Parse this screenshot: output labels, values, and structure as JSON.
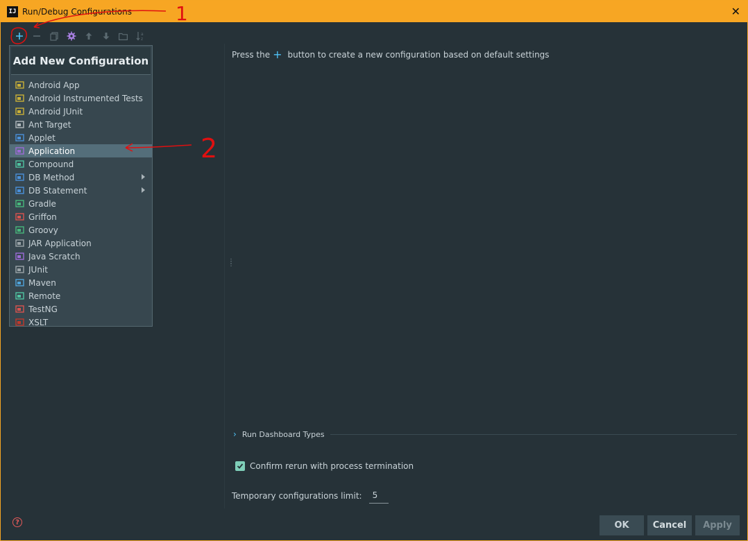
{
  "window": {
    "title": "Run/Debug Configurations",
    "icon_text": "IJ"
  },
  "toolbar": {
    "buttons": [
      {
        "name": "add-icon"
      },
      {
        "name": "remove-icon"
      },
      {
        "name": "copy-icon"
      },
      {
        "name": "settings-icon"
      },
      {
        "name": "move-up-icon"
      },
      {
        "name": "move-down-icon"
      },
      {
        "name": "folder-icon"
      },
      {
        "name": "sort-icon"
      }
    ]
  },
  "popup": {
    "header": "Add New Configuration",
    "items": [
      {
        "label": "Android App",
        "icon": "android-app-icon",
        "color": "#c9b038"
      },
      {
        "label": "Android Instrumented Tests",
        "icon": "android-tests-icon",
        "color": "#c9b038"
      },
      {
        "label": "Android JUnit",
        "icon": "android-junit-icon",
        "color": "#c9b038"
      },
      {
        "label": "Ant Target",
        "icon": "ant-icon",
        "color": "#b0b8bc"
      },
      {
        "label": "Applet",
        "icon": "applet-icon",
        "color": "#4a90d9"
      },
      {
        "label": "Application",
        "icon": "application-icon",
        "color": "#9b6bd6",
        "selected": true
      },
      {
        "label": "Compound",
        "icon": "compound-icon",
        "color": "#4fc3a1"
      },
      {
        "label": "DB Method",
        "icon": "db-method-icon",
        "color": "#4a90d9",
        "submenu": true
      },
      {
        "label": "DB Statement",
        "icon": "db-statement-icon",
        "color": "#4a90d9",
        "submenu": true
      },
      {
        "label": "Gradle",
        "icon": "gradle-icon",
        "color": "#48b77c"
      },
      {
        "label": "Griffon",
        "icon": "griffon-icon",
        "color": "#d9534f"
      },
      {
        "label": "Groovy",
        "icon": "groovy-icon",
        "color": "#48b77c"
      },
      {
        "label": "JAR Application",
        "icon": "jar-icon",
        "color": "#9aa4a8"
      },
      {
        "label": "Java Scratch",
        "icon": "java-scratch-icon",
        "color": "#9b6bd6"
      },
      {
        "label": "JUnit",
        "icon": "junit-icon",
        "color": "#9aa4a8"
      },
      {
        "label": "Maven",
        "icon": "maven-icon",
        "color": "#4fa3d9"
      },
      {
        "label": "Remote",
        "icon": "remote-icon",
        "color": "#4fc3a1"
      },
      {
        "label": "TestNG",
        "icon": "testng-icon",
        "color": "#d9534f"
      },
      {
        "label": "XSLT",
        "icon": "xslt-icon",
        "color": "#c0392b"
      }
    ]
  },
  "main": {
    "hint_before": "Press the",
    "hint_plus": "+",
    "hint_after": "button to create a new configuration based on default settings",
    "dashboard_label": "Run Dashboard Types",
    "confirm_label": "Confirm rerun with process termination",
    "confirm_checked": true,
    "limit_label": "Temporary configurations limit:",
    "limit_value": "5"
  },
  "footer": {
    "ok": "OK",
    "cancel": "Cancel",
    "apply": "Apply"
  },
  "annotations": {
    "mark_1": "1",
    "mark_2": "2"
  },
  "colors": {
    "titlebar": "#f7a623",
    "accent": "#4fc3f7",
    "selection": "#546e7a",
    "annotation": "#e01010"
  }
}
